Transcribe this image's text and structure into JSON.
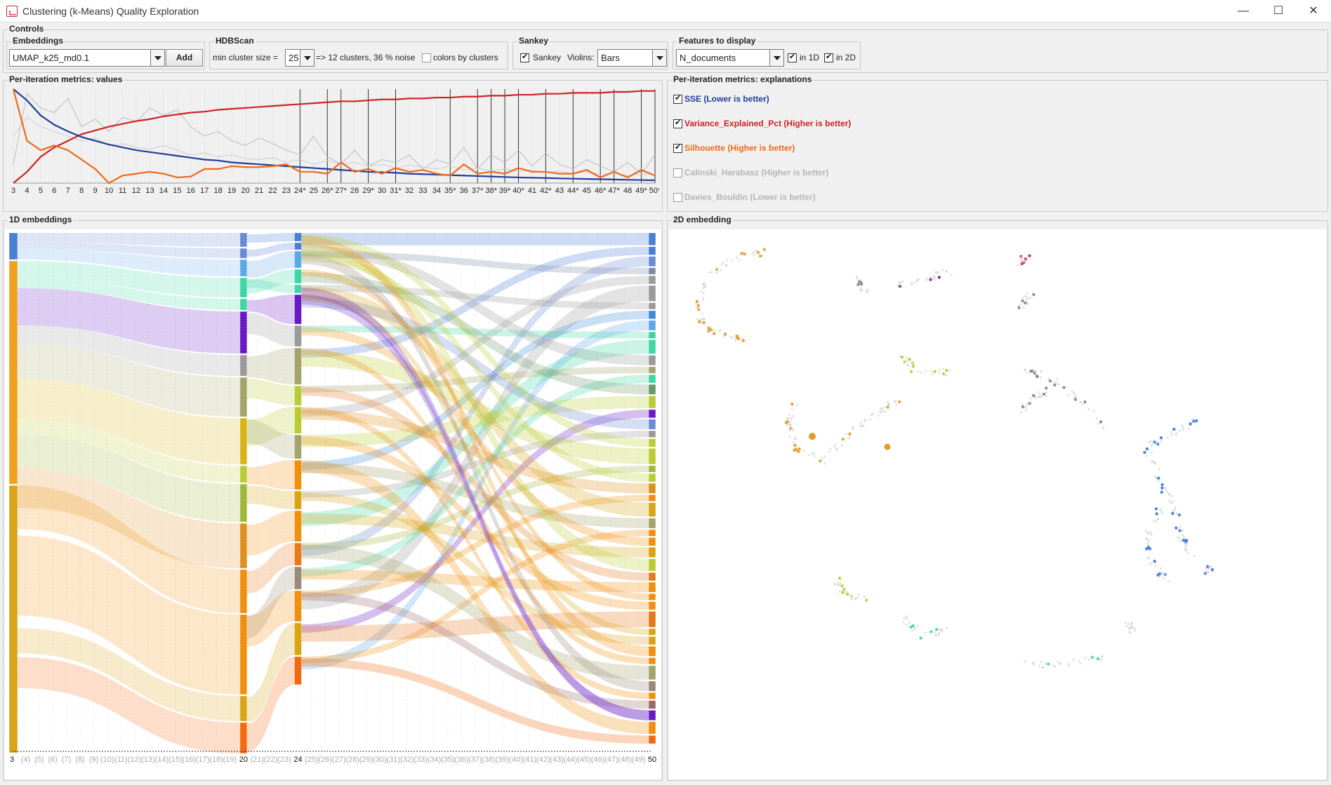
{
  "window": {
    "title": "Clustering (k-Means) Quality Exploration",
    "minimize": "—",
    "maximize": "☐",
    "close": "✕"
  },
  "controls": {
    "title": "Controls",
    "embeddings": {
      "title": "Embeddings",
      "selected": "UMAP_k25_md0.1",
      "add_label": "Add"
    },
    "hdbscan": {
      "title": "HDBScan",
      "min_cluster_label": "min cluster size =",
      "min_cluster_value": "25",
      "result": "=> 12 clusters, 36 % noise",
      "colors_label": "colors by clusters",
      "colors_checked": false
    },
    "sankey": {
      "title": "Sankey",
      "sankey_label": "Sankey",
      "sankey_checked": true,
      "violins_label": "Violins:",
      "violins_value": "Bars"
    },
    "features": {
      "title": "Features to display",
      "selected": "N_documents",
      "in1d_label": "in 1D",
      "in1d_checked": true,
      "in2d_label": "in 2D",
      "in2d_checked": true
    }
  },
  "metrics_values": {
    "title": "Per-iteration metrics: values",
    "x_labels": [
      "3",
      "4",
      "5",
      "6",
      "7",
      "8",
      "9",
      "10",
      "11",
      "12",
      "13",
      "14",
      "15",
      "16",
      "17",
      "18",
      "19",
      "20",
      "21",
      "22",
      "23",
      "24*",
      "25",
      "26*",
      "27*",
      "28",
      "29*",
      "30",
      "31*",
      "32",
      "33",
      "34",
      "35*",
      "36",
      "37*",
      "38*",
      "39*",
      "40*",
      "41",
      "42*",
      "43",
      "44*",
      "45",
      "46*",
      "47*",
      "48",
      "49*",
      "50*"
    ]
  },
  "chart_data": {
    "type": "line",
    "x": [
      3,
      4,
      5,
      6,
      7,
      8,
      9,
      10,
      11,
      12,
      13,
      14,
      15,
      16,
      17,
      18,
      19,
      20,
      21,
      22,
      23,
      24,
      25,
      26,
      27,
      28,
      29,
      30,
      31,
      32,
      33,
      34,
      35,
      36,
      37,
      38,
      39,
      40,
      41,
      42,
      43,
      44,
      45,
      46,
      47,
      48,
      49,
      50
    ],
    "starred": [
      24,
      26,
      27,
      29,
      31,
      35,
      37,
      38,
      39,
      40,
      42,
      44,
      46,
      47,
      49,
      50
    ],
    "ylim": [
      0,
      1
    ],
    "series": [
      {
        "name": "SSE",
        "color": "#1f3d99",
        "values": [
          1.0,
          0.88,
          0.72,
          0.62,
          0.55,
          0.49,
          0.45,
          0.41,
          0.38,
          0.35,
          0.33,
          0.31,
          0.29,
          0.27,
          0.25,
          0.24,
          0.22,
          0.21,
          0.2,
          0.19,
          0.18,
          0.17,
          0.16,
          0.15,
          0.14,
          0.13,
          0.12,
          0.115,
          0.11,
          0.1,
          0.095,
          0.09,
          0.085,
          0.08,
          0.075,
          0.07,
          0.065,
          0.06,
          0.057,
          0.054,
          0.05,
          0.047,
          0.044,
          0.041,
          0.038,
          0.035,
          0.032,
          0.03
        ]
      },
      {
        "name": "Variance_Explained_Pct",
        "color": "#cc2222",
        "values": [
          0.0,
          0.12,
          0.28,
          0.38,
          0.45,
          0.52,
          0.56,
          0.6,
          0.63,
          0.66,
          0.68,
          0.71,
          0.73,
          0.75,
          0.76,
          0.78,
          0.79,
          0.8,
          0.81,
          0.82,
          0.83,
          0.84,
          0.85,
          0.86,
          0.87,
          0.87,
          0.88,
          0.89,
          0.89,
          0.9,
          0.9,
          0.91,
          0.91,
          0.92,
          0.92,
          0.93,
          0.93,
          0.94,
          0.94,
          0.95,
          0.95,
          0.96,
          0.96,
          0.96,
          0.97,
          0.97,
          0.98,
          0.98
        ]
      },
      {
        "name": "Silhouette",
        "color": "#ee6a1a",
        "values": [
          1.0,
          0.45,
          0.35,
          0.4,
          0.35,
          0.25,
          0.15,
          0.0,
          0.08,
          0.1,
          0.12,
          0.1,
          0.06,
          0.07,
          0.15,
          0.15,
          0.18,
          0.17,
          0.17,
          0.18,
          0.2,
          0.12,
          0.12,
          0.1,
          0.22,
          0.12,
          0.15,
          0.1,
          0.16,
          0.12,
          0.14,
          0.1,
          0.08,
          0.2,
          0.1,
          0.12,
          0.1,
          0.16,
          0.12,
          0.12,
          0.1,
          0.1,
          0.14,
          0.06,
          0.12,
          0.06,
          0.14,
          0.08
        ]
      },
      {
        "name": "Calinski_Harabasz",
        "color": "#bbbbbb",
        "values": [
          0.2,
          0.95,
          0.8,
          0.75,
          0.9,
          0.6,
          0.68,
          0.55,
          0.7,
          0.65,
          0.8,
          0.72,
          0.78,
          0.6,
          0.5,
          0.55,
          0.45,
          0.4,
          0.48,
          0.42,
          0.35,
          0.3,
          0.5,
          0.28,
          0.2,
          0.35,
          0.18,
          0.25,
          0.22,
          0.3,
          0.15,
          0.25,
          0.2,
          0.38,
          0.15,
          0.3,
          0.22,
          0.35,
          0.18,
          0.32,
          0.2,
          0.15,
          0.25,
          0.18,
          0.12,
          0.22,
          0.1,
          0.3
        ]
      },
      {
        "name": "Davies_Bouldin",
        "color": "#cccccc",
        "values": [
          0.5,
          0.7,
          0.6,
          0.55,
          0.5,
          0.45,
          0.48,
          0.4,
          0.42,
          0.38,
          0.36,
          0.4,
          0.35,
          0.3,
          0.32,
          0.28,
          0.3,
          0.26,
          0.25,
          0.27,
          0.22,
          0.25,
          0.2,
          0.24,
          0.2,
          0.22,
          0.18,
          0.2,
          0.16,
          0.19,
          0.17,
          0.15,
          0.18,
          0.14,
          0.16,
          0.13,
          0.15,
          0.12,
          0.14,
          0.11,
          0.13,
          0.1,
          0.12,
          0.09,
          0.11,
          0.08,
          0.1,
          0.09
        ]
      }
    ]
  },
  "metrics_explanations": {
    "title": "Per-iteration metrics: explanations",
    "items": [
      {
        "label": "SSE (Lower is better)",
        "color": "#1f3d99",
        "checked": true
      },
      {
        "label": "Variance_Explained_Pct (Higher is better)",
        "color": "#cc2222",
        "checked": true
      },
      {
        "label": "Silhouette (Higher is better)",
        "color": "#ee6a1a",
        "checked": true
      },
      {
        "label": "Calinski_Harabasz (Higher is better)",
        "color": "#aaaaaa",
        "checked": false
      },
      {
        "label": "Davies_Bouldin (Lower is better)",
        "color": "#aaaaaa",
        "checked": false
      }
    ]
  },
  "embeddings_1d": {
    "title": "1D embeddings",
    "columns": [
      "3",
      "(4)",
      "(5)",
      "(6)",
      "(7)",
      "(8)",
      "(9)",
      "(10)",
      "(11)",
      "(12)",
      "(13)",
      "(14)",
      "(15)",
      "(16)",
      "(17)",
      "(18)",
      "(19)",
      "20",
      "(21)",
      "(22)",
      "(23)",
      "24",
      "(25)",
      "(26)",
      "(27)",
      "(28)",
      "(29)",
      "(30)",
      "(31)",
      "(32)",
      "(33)",
      "(34)",
      "(35)",
      "(36)",
      "(37)",
      "(38)",
      "(39)",
      "(40)",
      "(41)",
      "(42)",
      "(43)",
      "(44)",
      "(45)",
      "(46)",
      "(47)",
      "(48)",
      "(49)",
      "50"
    ]
  },
  "embedding_2d": {
    "title": "2D embedding"
  }
}
